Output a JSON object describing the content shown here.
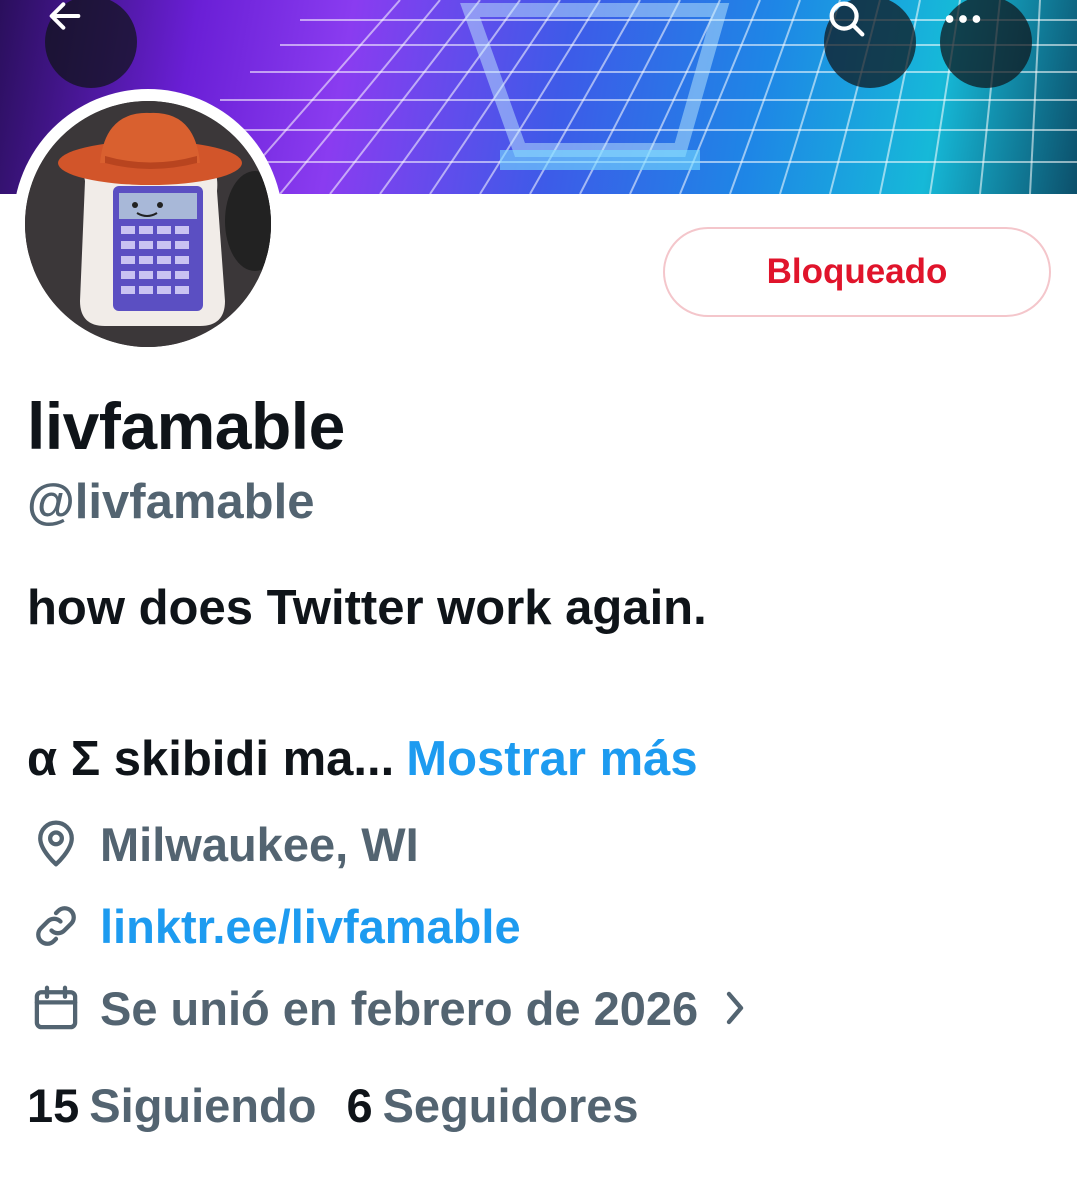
{
  "header": {
    "back_icon": "arrow-left-icon",
    "search_icon": "search-icon",
    "more_icon": "more-horizontal-icon"
  },
  "profile": {
    "blocked_label": "Bloqueado",
    "display_name": "livfamable",
    "handle": "@livfamable",
    "bio_line1": "how does Twitter work again.",
    "bio_line2": "α Σ skibidi ma...",
    "show_more": "Mostrar más",
    "location": "Milwaukee, WI",
    "link": "linktr.ee/livfamable",
    "joined": "Se unió en febrero de 2026"
  },
  "stats": {
    "following_count": "15",
    "following_label": "Siguiendo",
    "followers_count": "6",
    "followers_label": "Seguidores"
  },
  "colors": {
    "accent": "#1d9bf0",
    "blocked": "#e0142b",
    "muted": "#536471",
    "text": "#0f1419"
  }
}
